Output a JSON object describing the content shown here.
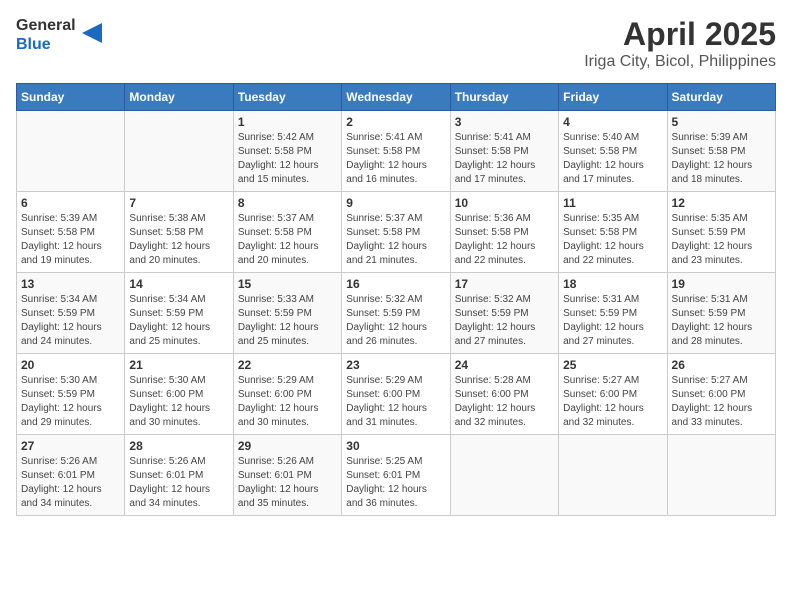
{
  "logo": {
    "line1": "General",
    "line2": "Blue"
  },
  "title": "April 2025",
  "subtitle": "Iriga City, Bicol, Philippines",
  "weekdays": [
    "Sunday",
    "Monday",
    "Tuesday",
    "Wednesday",
    "Thursday",
    "Friday",
    "Saturday"
  ],
  "weeks": [
    [
      {
        "day": "",
        "info": ""
      },
      {
        "day": "",
        "info": ""
      },
      {
        "day": "1",
        "info": "Sunrise: 5:42 AM\nSunset: 5:58 PM\nDaylight: 12 hours and 15 minutes."
      },
      {
        "day": "2",
        "info": "Sunrise: 5:41 AM\nSunset: 5:58 PM\nDaylight: 12 hours and 16 minutes."
      },
      {
        "day": "3",
        "info": "Sunrise: 5:41 AM\nSunset: 5:58 PM\nDaylight: 12 hours and 17 minutes."
      },
      {
        "day": "4",
        "info": "Sunrise: 5:40 AM\nSunset: 5:58 PM\nDaylight: 12 hours and 17 minutes."
      },
      {
        "day": "5",
        "info": "Sunrise: 5:39 AM\nSunset: 5:58 PM\nDaylight: 12 hours and 18 minutes."
      }
    ],
    [
      {
        "day": "6",
        "info": "Sunrise: 5:39 AM\nSunset: 5:58 PM\nDaylight: 12 hours and 19 minutes."
      },
      {
        "day": "7",
        "info": "Sunrise: 5:38 AM\nSunset: 5:58 PM\nDaylight: 12 hours and 20 minutes."
      },
      {
        "day": "8",
        "info": "Sunrise: 5:37 AM\nSunset: 5:58 PM\nDaylight: 12 hours and 20 minutes."
      },
      {
        "day": "9",
        "info": "Sunrise: 5:37 AM\nSunset: 5:58 PM\nDaylight: 12 hours and 21 minutes."
      },
      {
        "day": "10",
        "info": "Sunrise: 5:36 AM\nSunset: 5:58 PM\nDaylight: 12 hours and 22 minutes."
      },
      {
        "day": "11",
        "info": "Sunrise: 5:35 AM\nSunset: 5:58 PM\nDaylight: 12 hours and 22 minutes."
      },
      {
        "day": "12",
        "info": "Sunrise: 5:35 AM\nSunset: 5:59 PM\nDaylight: 12 hours and 23 minutes."
      }
    ],
    [
      {
        "day": "13",
        "info": "Sunrise: 5:34 AM\nSunset: 5:59 PM\nDaylight: 12 hours and 24 minutes."
      },
      {
        "day": "14",
        "info": "Sunrise: 5:34 AM\nSunset: 5:59 PM\nDaylight: 12 hours and 25 minutes."
      },
      {
        "day": "15",
        "info": "Sunrise: 5:33 AM\nSunset: 5:59 PM\nDaylight: 12 hours and 25 minutes."
      },
      {
        "day": "16",
        "info": "Sunrise: 5:32 AM\nSunset: 5:59 PM\nDaylight: 12 hours and 26 minutes."
      },
      {
        "day": "17",
        "info": "Sunrise: 5:32 AM\nSunset: 5:59 PM\nDaylight: 12 hours and 27 minutes."
      },
      {
        "day": "18",
        "info": "Sunrise: 5:31 AM\nSunset: 5:59 PM\nDaylight: 12 hours and 27 minutes."
      },
      {
        "day": "19",
        "info": "Sunrise: 5:31 AM\nSunset: 5:59 PM\nDaylight: 12 hours and 28 minutes."
      }
    ],
    [
      {
        "day": "20",
        "info": "Sunrise: 5:30 AM\nSunset: 5:59 PM\nDaylight: 12 hours and 29 minutes."
      },
      {
        "day": "21",
        "info": "Sunrise: 5:30 AM\nSunset: 6:00 PM\nDaylight: 12 hours and 30 minutes."
      },
      {
        "day": "22",
        "info": "Sunrise: 5:29 AM\nSunset: 6:00 PM\nDaylight: 12 hours and 30 minutes."
      },
      {
        "day": "23",
        "info": "Sunrise: 5:29 AM\nSunset: 6:00 PM\nDaylight: 12 hours and 31 minutes."
      },
      {
        "day": "24",
        "info": "Sunrise: 5:28 AM\nSunset: 6:00 PM\nDaylight: 12 hours and 32 minutes."
      },
      {
        "day": "25",
        "info": "Sunrise: 5:27 AM\nSunset: 6:00 PM\nDaylight: 12 hours and 32 minutes."
      },
      {
        "day": "26",
        "info": "Sunrise: 5:27 AM\nSunset: 6:00 PM\nDaylight: 12 hours and 33 minutes."
      }
    ],
    [
      {
        "day": "27",
        "info": "Sunrise: 5:26 AM\nSunset: 6:01 PM\nDaylight: 12 hours and 34 minutes."
      },
      {
        "day": "28",
        "info": "Sunrise: 5:26 AM\nSunset: 6:01 PM\nDaylight: 12 hours and 34 minutes."
      },
      {
        "day": "29",
        "info": "Sunrise: 5:26 AM\nSunset: 6:01 PM\nDaylight: 12 hours and 35 minutes."
      },
      {
        "day": "30",
        "info": "Sunrise: 5:25 AM\nSunset: 6:01 PM\nDaylight: 12 hours and 36 minutes."
      },
      {
        "day": "",
        "info": ""
      },
      {
        "day": "",
        "info": ""
      },
      {
        "day": "",
        "info": ""
      }
    ]
  ]
}
